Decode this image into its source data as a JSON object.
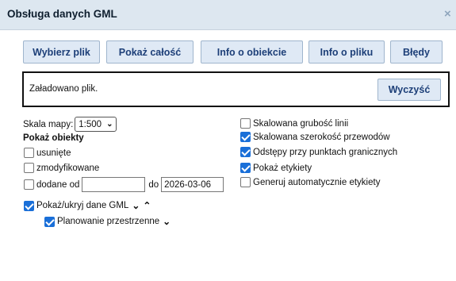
{
  "window": {
    "title": "Obsługa danych GML",
    "close_label": "×"
  },
  "toolbar": {
    "select_file": "Wybierz plik",
    "show_all": "Pokaż całość",
    "object_info": "Info o obiekcie",
    "file_info": "Info o pliku",
    "errors": "Błędy"
  },
  "message": {
    "text": "Załadowano plik.",
    "clear": "Wyczyść"
  },
  "scale": {
    "label": "Skala mapy:",
    "value": "1:500",
    "chevron": "⌄"
  },
  "show_objects": {
    "heading": "Pokaż obiekty",
    "deleted": {
      "label": "usunięte",
      "checked": false
    },
    "modified": {
      "label": "zmodyfikowane",
      "checked": false
    },
    "added": {
      "label": "dodane od",
      "checked": false,
      "from": "",
      "to_label": "do",
      "to": "2026-03-06"
    }
  },
  "options": {
    "scaled_line_width": {
      "label": "Skalowana grubość linii",
      "checked": false
    },
    "scaled_wire_width": {
      "label": "Skalowana szerokość przewodów",
      "checked": true
    },
    "boundary_gaps": {
      "label": "Odstępy przy punktach granicznych",
      "checked": true
    },
    "show_labels": {
      "label": "Pokaż etykiety",
      "checked": true
    },
    "auto_labels": {
      "label": "Generuj automatycznie etykiety",
      "checked": false
    }
  },
  "layers": {
    "gml": {
      "label": "Pokaż/ukryj dane GML",
      "checked": true,
      "collapse": "⌄",
      "expand": "⌃"
    },
    "planning": {
      "label": "Planowanie przestrzenne",
      "checked": true,
      "collapse": "⌄"
    }
  }
}
